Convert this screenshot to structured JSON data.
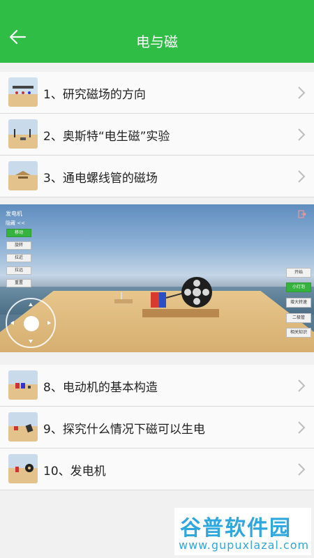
{
  "header": {
    "title": "电与磁",
    "back_icon": "arrow-left-icon",
    "bg_color": "#2fbd45"
  },
  "list": {
    "items": [
      {
        "label": "1、研究磁场的方向"
      },
      {
        "label": "2、奥斯特“电生磁”实验"
      },
      {
        "label": "3、通电螺线管的磁场"
      },
      {
        "label": "8、电动机的基本构造"
      },
      {
        "label": "9、探究什么情况下磁可以生电"
      },
      {
        "label": "10、发电机"
      }
    ]
  },
  "simulation": {
    "title": "发电机",
    "hide_label": "隐藏 <<",
    "left_buttons": [
      {
        "label": "移动",
        "active": true
      },
      {
        "label": "旋转",
        "active": false
      },
      {
        "label": "拉近",
        "active": false
      },
      {
        "label": "拉远",
        "active": false
      },
      {
        "label": "重置",
        "active": false
      }
    ],
    "right_buttons": [
      {
        "label": "开始",
        "active": false
      },
      {
        "label": "小灯泡",
        "active": true
      },
      {
        "label": "增大转速",
        "active": false
      },
      {
        "label": "二极管",
        "active": false
      },
      {
        "label": "相关知识",
        "active": false
      }
    ]
  },
  "watermark": {
    "title": "谷普软件园",
    "subtitle": "www.gupuxlazal.com"
  }
}
